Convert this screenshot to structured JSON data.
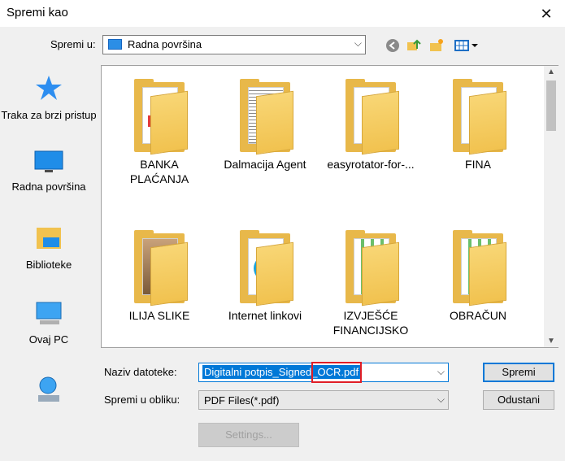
{
  "window": {
    "title": "Spremi kao",
    "close_symbol": "✕"
  },
  "toolbar": {
    "save_in_label": "Spremi u:",
    "save_in_value": "Radna površina"
  },
  "places": [
    {
      "label": "Traka za brzi pristup",
      "icon": "star-icon"
    },
    {
      "label": "Radna površina",
      "icon": "desktop-icon"
    },
    {
      "label": "Biblioteke",
      "icon": "libraries-icon"
    },
    {
      "label": "Ovaj PC",
      "icon": "computer-icon"
    },
    {
      "label": "",
      "icon": "network-icon"
    }
  ],
  "files": [
    {
      "label": "BANKA PLAĆANJA",
      "preview": "pdf"
    },
    {
      "label": "Dalmacija Agent",
      "preview": "document"
    },
    {
      "label": "easyrotator-for-...",
      "preview": "blank"
    },
    {
      "label": "FINA",
      "preview": "pdf"
    },
    {
      "label": "ILIJA SLIKE",
      "preview": "photo"
    },
    {
      "label": "Internet linkovi",
      "preview": "edge"
    },
    {
      "label": "IZVJEŠĆE FINANCIJSKO",
      "preview": "spreadsheet"
    },
    {
      "label": "OBRAČUN",
      "preview": "spreadsheet"
    }
  ],
  "form": {
    "filename_label": "Naziv datoteke:",
    "filename_value": "Digitalni potpis_Signed_OCR.pdf",
    "filetype_label": "Spremi u obliku:",
    "filetype_value": "PDF Files(*.pdf)"
  },
  "buttons": {
    "save": "Spremi",
    "cancel": "Odustani",
    "settings": "Settings..."
  },
  "colors": {
    "accent": "#0078d7",
    "highlight_box": "#e01e26",
    "folder": "#f1c24f"
  }
}
